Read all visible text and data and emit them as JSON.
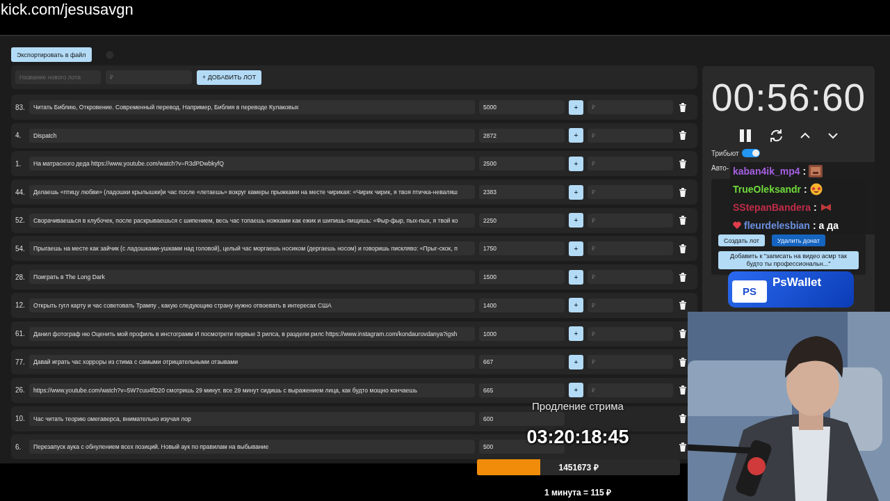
{
  "address_bar": {
    "url": "kick.com/jesusavgn"
  },
  "toolbar": {
    "export_button": "Экспортировать в файл"
  },
  "new_lot": {
    "name_placeholder": "Название нового лота",
    "price_placeholder": "₽",
    "add_button": "+ ДОБАВИТЬ ЛОТ"
  },
  "lots": [
    {
      "number": "83.",
      "title": "Читать Библию, Откровение. Современный перевод. Например, Библия в переводе Кулаковых",
      "amount": "5000",
      "add_button": "+",
      "price_placeholder": "₽"
    },
    {
      "number": "4.",
      "title": "Dispatch",
      "amount": "2872",
      "add_button": "+",
      "price_placeholder": "₽"
    },
    {
      "number": "1.",
      "title": "На матрасного деда https://www.youtube.com/watch?v=R3dPDwbkyfQ",
      "amount": "2500",
      "add_button": "+",
      "price_placeholder": "₽"
    },
    {
      "number": "44.",
      "title": "Делаешь «птицу любви» (ладошки крылышки)и час после «летаешь» вокруг камеры прыжками на месте чирикая: «Чирик чирик, я твоя птичка-неваляш",
      "amount": "2383",
      "add_button": "+",
      "price_placeholder": "₽"
    },
    {
      "number": "52.",
      "title": "Сворачиваешься в клубочек, после раскрываешься с шипением, весь час топаешь ножками как ежик и шипишь-пищишь: «Фыр-фыр, пых-пых, я твой ко",
      "amount": "2250",
      "add_button": "+",
      "price_placeholder": "₽"
    },
    {
      "number": "54.",
      "title": "Прыгаешь на месте как зайчик (с ладошками-ушками над головой), целый час моргаешь носиком (дергаешь носом) и говоришь пискляво: «Прыг-скок, п",
      "amount": "1750",
      "add_button": "+",
      "price_placeholder": "₽"
    },
    {
      "number": "28.",
      "title": "Поиграть в The Long Dark",
      "amount": "1500",
      "add_button": "+",
      "price_placeholder": "₽"
    },
    {
      "number": "12.",
      "title": "Открыть гугл карту и час советовать Трампу , какую следующию страну нужно отвоевать в интересах США",
      "amount": "1400",
      "add_button": "+",
      "price_placeholder": "₽"
    },
    {
      "number": "61.",
      "title": "Данил фотограф ню Оценить мой профиль в инстограмм И посмотрети первые 3 рилса, в раздели рилс https://www.instagram.com/kondaurovdanya?igsh",
      "amount": "1000",
      "add_button": "+",
      "price_placeholder": "₽"
    },
    {
      "number": "77.",
      "title": "Давай играть час хорроры из стима с самыми отрицательными отзывами",
      "amount": "667",
      "add_button": "+",
      "price_placeholder": "₽"
    },
    {
      "number": "26.",
      "title": "https://www.youtube.com/watch?v=5W7cuu4fD20 смотришь 29 минут. все 29 минут сидишь с выражением лица, как будто мощно кончаешь",
      "amount": "665",
      "add_button": "+",
      "price_placeholder": "₽"
    },
    {
      "number": "10.",
      "title": "Час читать теорию омегаверса, внимательно изучая лор",
      "amount": "600"
    },
    {
      "number": "6.",
      "title": "Перезапуск аука с обнулением всех позиций. Новый аук по правилам на выбывание",
      "amount": "500"
    }
  ],
  "timer": {
    "time": "00:56:60"
  },
  "toggles": [
    {
      "label": "Трибьют",
      "on": true
    },
    {
      "label": "Авто-"
    }
  ],
  "donation": {
    "buttons": [
      {
        "label": "Создать лот",
        "kind": "light"
      },
      {
        "label": "Удалить донат",
        "kind": "primary"
      }
    ],
    "add_to_lot_button": "Добавить к \"записать на видео асмр так будто ты профессиональн...\""
  },
  "chat": [
    {
      "user": "kaban4ik_mp4",
      "color": "#a35fe0",
      "separator": ":",
      "kind": "meme"
    },
    {
      "user": "TrueOleksandr",
      "color": "#6fd93a",
      "separator": ":",
      "kind": "emoji"
    },
    {
      "user": "SStepanBandera",
      "color": "#c02c48",
      "separator": ":",
      "kind": "bow"
    },
    {
      "user": "fleurdelesbian",
      "color": "#6b8fe0",
      "separator": ":",
      "text": "а да",
      "kind": "badge"
    }
  ],
  "wallet_banner": {
    "logo": "PS",
    "name": "PsWallet"
  },
  "extension": {
    "title": "Продление стрима",
    "time": "03:20:18:45"
  },
  "goal": {
    "level": 0.31,
    "amount": "1451673 ₽",
    "rate": "1 минута = 115 ₽"
  }
}
